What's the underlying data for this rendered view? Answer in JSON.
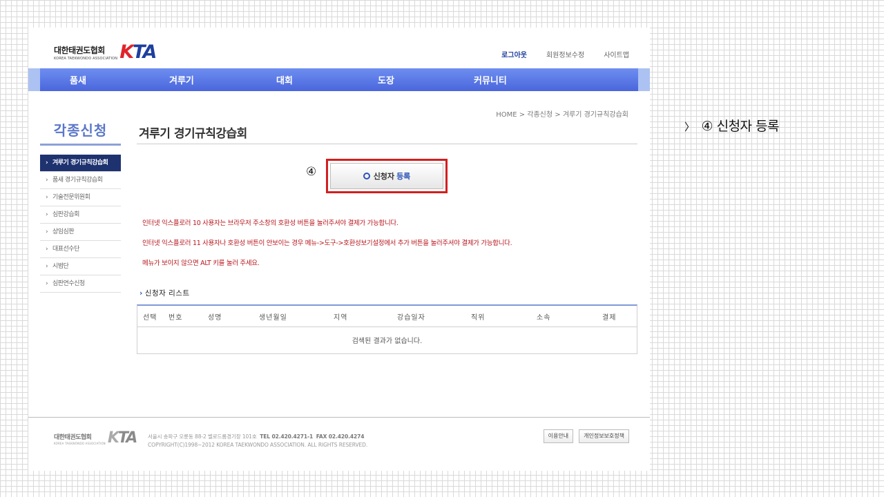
{
  "header": {
    "logo_ko": "대한태권도협회",
    "logo_en": "KOREA TAEKWONDO ASSOCIATION",
    "logo_mark_k": "K",
    "logo_mark_ta": "TA",
    "util": [
      "로그아웃",
      "회원정보수정",
      "사이트맵"
    ]
  },
  "gnb": [
    "품새",
    "겨루기",
    "대회",
    "도장",
    "커뮤니티"
  ],
  "lnb": {
    "title": "각종신청",
    "items": [
      "겨루기 경기규칙강습회",
      "품새 경기규칙강습회",
      "기술전문위원회",
      "심판강습회",
      "상임심판",
      "대표선수단",
      "시범단",
      "심판연수신청"
    ]
  },
  "breadcrumb": "HOME > 각종신청 > 겨루기 경기규칙강습회",
  "page_title": "겨루기 경기규칙강습회",
  "step_label": "④",
  "register_button": {
    "prefix": "신청자",
    "label": "등록"
  },
  "notices": [
    "인터넷 익스플로러 10 사용자는 브라우저 주소창의 호환성 버튼을 눌러주셔야 결제가 가능합니다.",
    "인터넷 익스플로러 11 사용자나 호환성 버튼이 안보이는 경우 메뉴->도구->호환성보기설정에서 추가 버튼을 눌러주셔야 결제가 가능합니다.",
    "메뉴가 보이지 않으면 ALT 키를 눌러 주세요."
  ],
  "list_title": "신청자 리스트",
  "table": {
    "columns": [
      "선택",
      "번호",
      "성명",
      "생년월일",
      "지역",
      "강습일자",
      "직위",
      "소속",
      "결제"
    ],
    "empty_text": "검색된 결과가 없습니다."
  },
  "footer": {
    "logo_ko": "대한태권도협회",
    "logo_en": "KOREA TAEKWONDO ASSOCIATION",
    "address": "서울시 송파구 오륜동 88-2 벨로드롬경기장 101호",
    "tel": "TEL 02.420.4271-1",
    "fax": "FAX 02.420.4274",
    "copyright": "COPYRIGHT(C)1998~2012 KOREA TAEKWONDO ASSOCIATION. ALL RIGHTS RESERVED.",
    "buttons": [
      "이용안내",
      "개인정보보호정책"
    ]
  },
  "annotation": {
    "arrow": "〉",
    "text": "④ 신청자 등록"
  },
  "colors": {
    "accent": "#1f3f9e",
    "nav": "#4a66dc",
    "notice": "#b8141b",
    "highlight_frame": "#d21f1f"
  }
}
